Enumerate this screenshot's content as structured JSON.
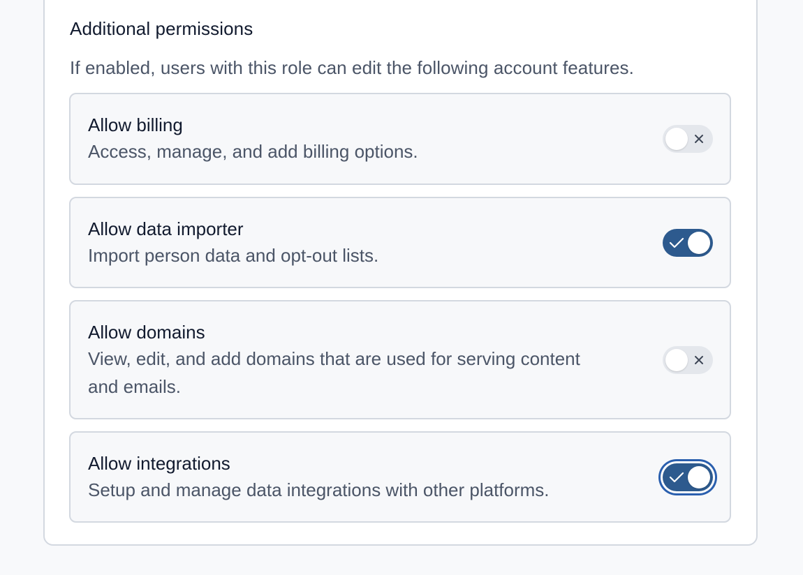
{
  "section": {
    "title": "Additional permissions",
    "description": "If enabled, users with this role can edit the following account features."
  },
  "permissions": [
    {
      "title": "Allow billing",
      "description": "Access, manage, and add billing options.",
      "enabled": false,
      "icon": "x-icon"
    },
    {
      "title": "Allow data importer",
      "description": "Import person data and opt-out lists.",
      "enabled": true,
      "icon": "check-icon"
    },
    {
      "title": "Allow domains",
      "description": "View, edit, and add domains that are used for serving content and emails.",
      "enabled": false,
      "icon": "x-icon"
    },
    {
      "title": "Allow integrations",
      "description": "Setup and manage data integrations with other platforms.",
      "enabled": true,
      "focused": true,
      "icon": "check-icon"
    }
  ],
  "colors": {
    "toggle_on": "#2d5a8e",
    "toggle_off": "#e4e7ec",
    "focus_ring": "#2a5fae"
  }
}
